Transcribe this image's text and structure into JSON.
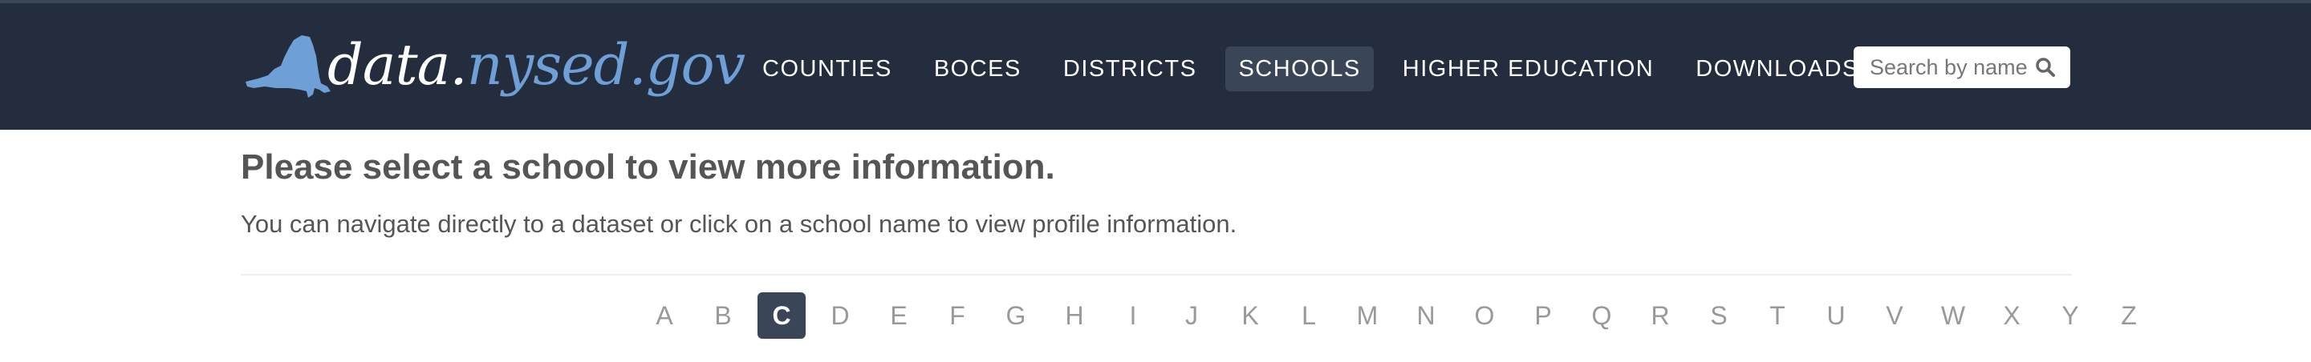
{
  "header": {
    "logo": {
      "prefix": "data.",
      "highlight": "nysed.gov"
    },
    "nav": [
      {
        "label": "COUNTIES",
        "active": false
      },
      {
        "label": "BOCES",
        "active": false
      },
      {
        "label": "DISTRICTS",
        "active": false
      },
      {
        "label": "SCHOOLS",
        "active": true
      },
      {
        "label": "HIGHER EDUCATION",
        "active": false
      },
      {
        "label": "DOWNLOADS",
        "active": false
      }
    ],
    "search": {
      "placeholder": "Search by name",
      "icon": "search-icon"
    }
  },
  "main": {
    "heading": "Please select a school to view more information.",
    "subtext": "You can navigate directly to a dataset or click on a school name to view profile information.",
    "alphabet": [
      "A",
      "B",
      "C",
      "D",
      "E",
      "F",
      "G",
      "H",
      "I",
      "J",
      "K",
      "L",
      "M",
      "N",
      "O",
      "P",
      "Q",
      "R",
      "S",
      "T",
      "U",
      "V",
      "W",
      "X",
      "Y",
      "Z"
    ],
    "active_letter": "C"
  },
  "colors": {
    "header_bg": "#232d3d",
    "active_bg": "#3a4658",
    "logo_accent": "#6e9fd6",
    "text": "#555555",
    "letter_inactive": "#999999"
  }
}
